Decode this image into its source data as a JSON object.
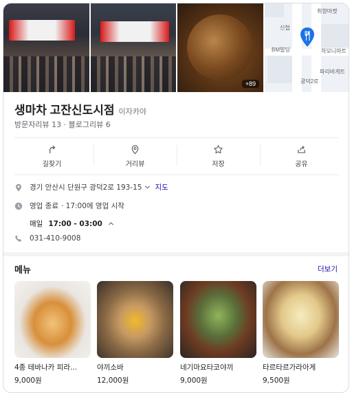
{
  "photos": {
    "more_count": "+89",
    "map_labels": [
      "취향마켓",
      "신협",
      "BM빌딩",
      "하모니마트",
      "파리바게트",
      "광덕2로"
    ]
  },
  "place": {
    "name": "생마차 고잔신도시점",
    "category": "이자카야",
    "visitor_reviews": "방문자리뷰 13",
    "separator": "·",
    "blog_reviews": "블로그리뷰 6"
  },
  "actions": [
    {
      "label": "길찾기",
      "icon": "directions-icon"
    },
    {
      "label": "거리뷰",
      "icon": "street-view-icon"
    },
    {
      "label": "저장",
      "icon": "star-icon"
    },
    {
      "label": "공유",
      "icon": "share-icon"
    }
  ],
  "info": {
    "address": "경기 안산시 단원구 광덕2로 193-15",
    "map_link": "지도",
    "status": "영업 종료",
    "status_detail": "· 17:00에 영업 시작",
    "hours_day": "매일",
    "hours_time": "17:00 - 03:00",
    "phone": "031-410-9008"
  },
  "menu": {
    "heading": "메뉴",
    "more": "더보기",
    "items": [
      {
        "name": "4종 테바나카 피라...",
        "price": "9,000원"
      },
      {
        "name": "야끼소바",
        "price": "12,000원"
      },
      {
        "name": "네기마요타코야끼",
        "price": "9,000원"
      },
      {
        "name": "타르타르가라아게",
        "price": "9,500원"
      }
    ]
  },
  "colors": {
    "link": "#1a0dab",
    "pin": "#1a73e8"
  }
}
